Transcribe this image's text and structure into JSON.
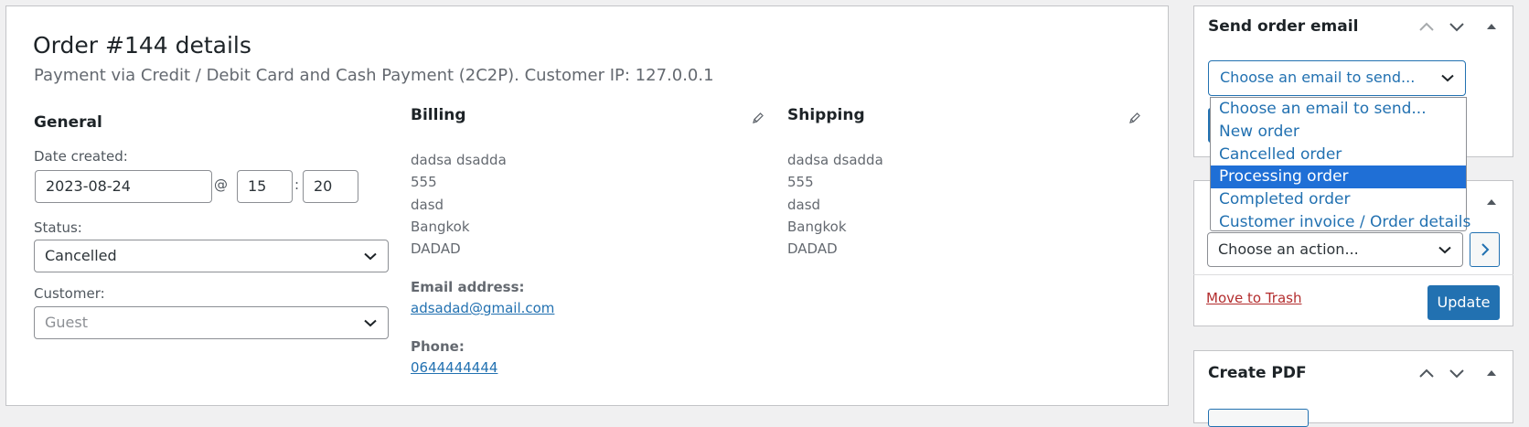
{
  "order": {
    "title": "Order #144 details",
    "subtitle": "Payment via Credit / Debit Card and Cash Payment (2C2P). Customer IP: 127.0.0.1"
  },
  "general": {
    "heading": "General",
    "date_label": "Date created:",
    "date_value": "2023-08-24",
    "at": "@",
    "hour": "15",
    "colon": ":",
    "minute": "20",
    "status_label": "Status:",
    "status_value": "Cancelled",
    "customer_label": "Customer:",
    "customer_value": "Guest"
  },
  "billing": {
    "heading": "Billing",
    "address": [
      "dadsa dsadda",
      "555",
      "dasd",
      "Bangkok",
      "DADAD"
    ],
    "email_label": "Email address:",
    "email": "adsadad@gmail.com",
    "phone_label": "Phone:",
    "phone": "0644444444"
  },
  "shipping": {
    "heading": "Shipping",
    "address": [
      "dadsa dsadda",
      "555",
      "dasd",
      "Bangkok",
      "DADAD"
    ]
  },
  "send_email": {
    "title": "Send order email",
    "select_value": "Choose an email to send...",
    "options": [
      "Choose an email to send...",
      "New order",
      "Cancelled order",
      "Processing order",
      "Completed order",
      "Customer invoice / Order details"
    ],
    "highlighted": "Processing order"
  },
  "actions": {
    "select_value": "Choose an action...",
    "trash_label": "Move to Trash",
    "update_label": "Update"
  },
  "create_pdf": {
    "title": "Create PDF"
  },
  "colors": {
    "accent": "#2271b1",
    "highlight": "#1f6fd6",
    "danger": "#b32d2e"
  }
}
